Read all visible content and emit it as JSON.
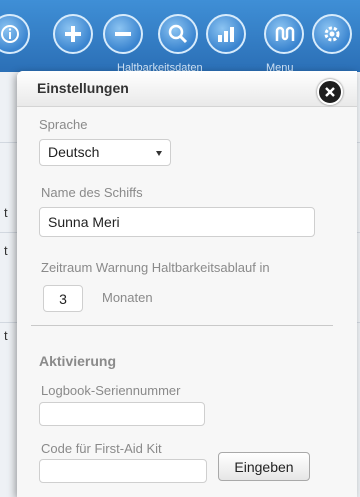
{
  "toolbar": {
    "caption_left": "Haltbarkeitsdaten",
    "caption_right": "Menu",
    "buttons": [
      "info-icon",
      "add-icon",
      "remove-icon",
      "search-icon",
      "chart-icon",
      "logbook-icon",
      "gear-icon"
    ]
  },
  "background": {
    "row_marks": [
      "t",
      "t",
      "t"
    ]
  },
  "settings": {
    "title": "Einstellungen",
    "language_label": "Sprache",
    "language_value": "Deutsch",
    "ship_name_label": "Name des Schiffs",
    "ship_name_value": "Sunna Meri",
    "warning_label": "Zeitraum Warnung Haltbarkeitsablauf in",
    "warning_value": "3",
    "warning_unit": "Monaten",
    "activation_heading": "Aktivierung",
    "serial_label": "Logbook-Seriennummer",
    "serial_value": "",
    "firstaid_label": "Code für First-Aid Kit",
    "firstaid_value": "",
    "submit_label": "Eingeben"
  },
  "colors": {
    "toolbar": "#2b6fb6",
    "popup_bg": "#f7f7f7",
    "close_btn": "#1e1e1e"
  }
}
